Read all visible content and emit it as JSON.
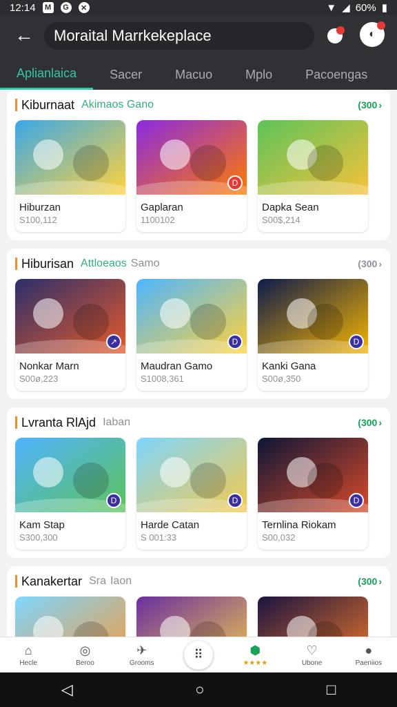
{
  "status": {
    "time": "12:14",
    "battery": "60%"
  },
  "appbar": {
    "search_text": "Moraital Marrkekeplace"
  },
  "tabs": [
    "Aplianlaica",
    "Sacer",
    "Macuo",
    "Mplo",
    "Pacoengas"
  ],
  "sections": [
    {
      "title": "Kiburnaat",
      "subtitle": "Akimaos Gano",
      "subtitle_color": "#33b07a",
      "more": "(300",
      "more_color": "#1aa15a",
      "cards": [
        {
          "name": "Hiburzan",
          "price": "S100,112",
          "scene": "cartoon-friends",
          "bg": [
            "#3aa8e8",
            "#ffd23c"
          ],
          "badge": ""
        },
        {
          "name": "Gaplaran",
          "price": "1100102",
          "scene": "puzzle-game",
          "bg": [
            "#8a2be2",
            "#ff7a00"
          ],
          "badge": "D"
        },
        {
          "name": "Dapka Sean",
          "price": "S00$,214",
          "scene": "jungle-animals",
          "bg": [
            "#5cc35a",
            "#f6c23a"
          ],
          "badge": ""
        }
      ]
    },
    {
      "title": "Hiburisan",
      "subtitle": "Attloeaos",
      "subtitle2": "Samo",
      "subtitle_color": "#33b07a",
      "more": "(300",
      "more_color": "#8e9196",
      "cards": [
        {
          "name": "Nonkar Marn",
          "price": "S00ø,223",
          "scene": "na-mauous",
          "bg": [
            "#2a2f6b",
            "#e65a2a"
          ],
          "badge": "↗"
        },
        {
          "name": "Maudran Gamo",
          "price": "S1008,361",
          "scene": "hernan-comrs",
          "bg": [
            "#4db6ff",
            "#ffd23c"
          ],
          "badge": "D"
        },
        {
          "name": "Kanki Gana",
          "price": "S00ø,350",
          "scene": "somms",
          "bg": [
            "#0d1b4c",
            "#f5b400"
          ],
          "badge": "D"
        }
      ]
    },
    {
      "title": "Lvranta RlAjd",
      "subtitle": "Iaban",
      "subtitle_color": "#8e9196",
      "more": "(300",
      "more_color": "#1aa15a",
      "cards": [
        {
          "name": "Kam Stap",
          "price": "S300,300",
          "scene": "bububs",
          "bg": [
            "#4fb3ff",
            "#5cc35a"
          ],
          "badge": "D"
        },
        {
          "name": "Harde Catan",
          "price": "S 001:33",
          "scene": "camlsean",
          "bg": [
            "#7ed6ff",
            "#f2c94c"
          ],
          "badge": "D"
        },
        {
          "name": "Ternlina Riokam",
          "price": "S00,032",
          "scene": "night-bear",
          "bg": [
            "#0c1636",
            "#d94a2a"
          ],
          "badge": "D"
        }
      ]
    },
    {
      "title": "Kanakertar",
      "subtitle": "Sra",
      "subtitle2": "Iaon",
      "subtitle_color": "#8e9196",
      "more": "(300",
      "more_color": "#1aa15a",
      "cards": [
        {
          "name": "",
          "price": "",
          "scene": "fox-beach",
          "bg": [
            "#7ed6ff",
            "#f59a3a"
          ],
          "badge": ""
        },
        {
          "name": "",
          "price": "",
          "scene": "hero-kids",
          "bg": [
            "#6a2fa0",
            "#f2c94c"
          ],
          "badge": ""
        },
        {
          "name": "",
          "price": "",
          "scene": "wizard",
          "bg": [
            "#1a1340",
            "#f07a2a"
          ],
          "badge": ""
        }
      ]
    }
  ],
  "bottom_nav": [
    {
      "label": "Hecle",
      "icon": "home-icon"
    },
    {
      "label": "Beroo",
      "icon": "compass-icon"
    },
    {
      "label": "Grooms",
      "icon": "rocket-icon"
    },
    {
      "label": "",
      "icon": "grid-icon"
    },
    {
      "label": "★★★★",
      "icon": "shield-icon"
    },
    {
      "label": "Ubone",
      "icon": "heart-icon"
    },
    {
      "label": "Paeniios",
      "icon": "person-icon"
    }
  ],
  "colors": {
    "accent": "#33c7a6",
    "appbar": "#2f3134"
  }
}
